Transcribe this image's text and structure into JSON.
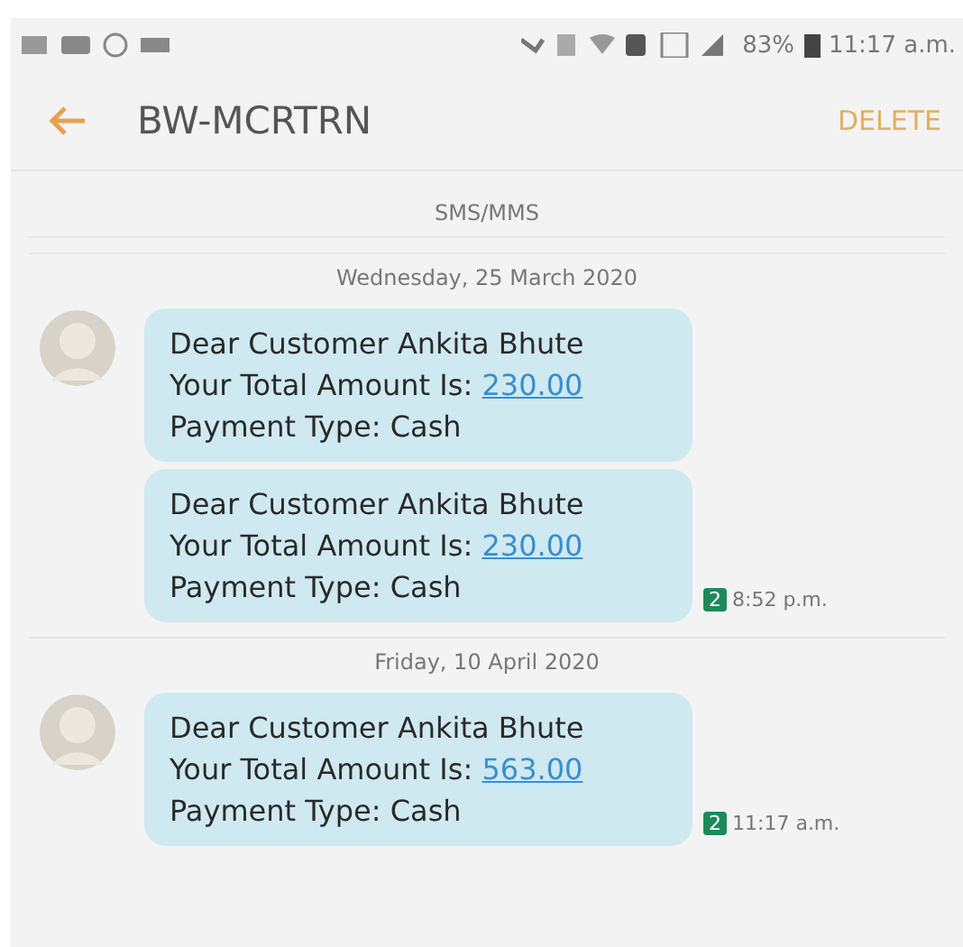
{
  "status_bar": {
    "battery": "83%",
    "time": "11:17 a.m."
  },
  "app_bar": {
    "title": "BW-MCRTRN",
    "action": "DELETE"
  },
  "channel": "SMS/MMS",
  "groups": [
    {
      "date": "Wednesday, 25 March 2020",
      "messages": [
        {
          "greeting": "Dear Customer Ankita Bhute",
          "amount_label": "Your Total Amount Is:",
          "amount": "230.00",
          "payment": "Payment Type: Cash"
        },
        {
          "greeting": "Dear Customer Ankita Bhute",
          "amount_label": "Your Total Amount Is:",
          "amount": "230.00",
          "payment": "Payment Type: Cash",
          "sim": "2",
          "time": "8:52 p.m."
        }
      ]
    },
    {
      "date": "Friday, 10 April 2020",
      "messages": [
        {
          "greeting": "Dear Customer Ankita Bhute",
          "amount_label": "Your Total Amount Is:",
          "amount": "563.00",
          "payment": "Payment Type: Cash",
          "sim": "2",
          "time": "11:17 a.m."
        }
      ]
    }
  ]
}
